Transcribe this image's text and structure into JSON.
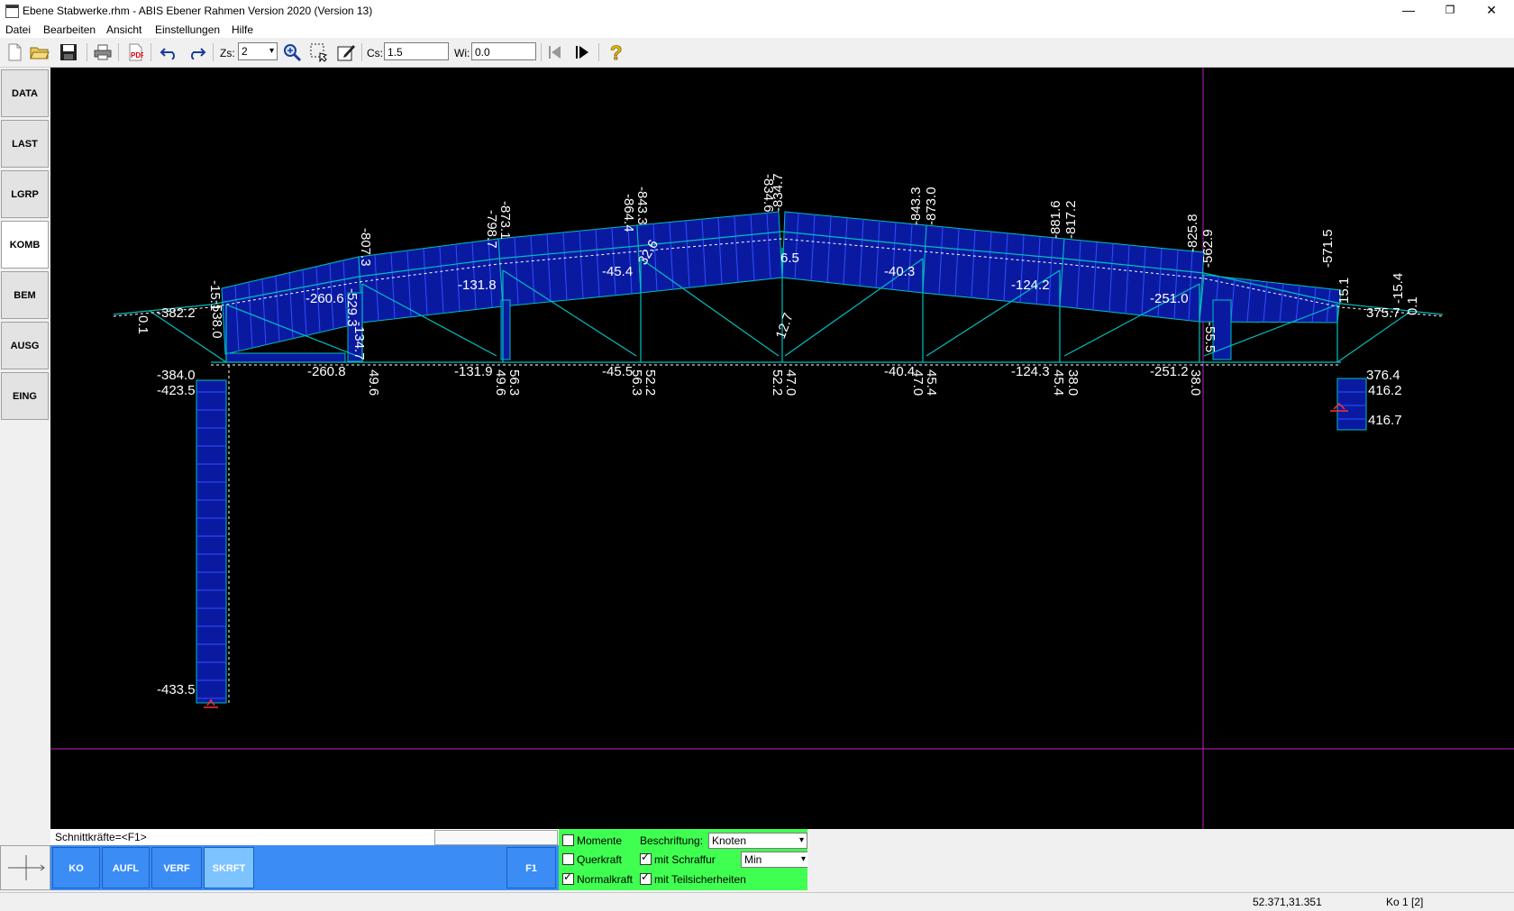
{
  "window": {
    "title": "Ebene Stabwerke.rhm - ABIS Ebener Rahmen Version 2020 (Version 13)",
    "minimize": "—",
    "restore": "❐",
    "close": "✕"
  },
  "menu": [
    "Datei",
    "Bearbeiten",
    "Ansicht",
    "Einstellungen",
    "Hilfe"
  ],
  "toolbar": {
    "zs_label": "Zs:",
    "zs_value": "2",
    "cs_label": "Cs:",
    "cs_value": "1.5",
    "wi_label": "Wi:",
    "wi_value": "0.0"
  },
  "sidebar": [
    "DATA",
    "LAST",
    "LGRP",
    "KOMB",
    "BEM",
    "AUSG",
    "EING"
  ],
  "sidebar_active": "KOMB",
  "status_line": {
    "label": "Schnittkräfte=<F1>"
  },
  "bottom_buttons": [
    "KO",
    "AUFL",
    "VERF",
    "SKRFT",
    "F1"
  ],
  "bottom_active": "SKRFT",
  "options": {
    "momente": "Momente",
    "querkraft": "Querkraft",
    "normalkraft": "Normalkraft",
    "beschriftung_label": "Beschriftung:",
    "beschriftung_value": "Knoten",
    "mit_schraffur": "mit Schraffur",
    "min_value": "Min",
    "mit_teilsicherheiten": "mit Teilsicherheiten",
    "checked": {
      "momente": false,
      "querkraft": false,
      "normalkraft": true,
      "mit_schraffur": true,
      "mit_teilsicherheiten": true
    }
  },
  "statusbar": {
    "coords": "52.371,31.351",
    "ko": "Ko 1 [2]"
  },
  "colors": {
    "canvas": "#000000",
    "member": "#00c0c0",
    "fill": "#0a1aa0",
    "hatch": "#3050ff",
    "labels": "#ffffff",
    "crosshair": "#c020c0",
    "green_panel": "#3fff50",
    "blue_bar": "#3b8cf5"
  },
  "diagram_labels": {
    "top_chord": [
      "-538.0",
      "-529.3",
      "-807.3",
      "-798.7",
      "-873.1",
      "-864.4",
      "-843.3",
      "-834.6",
      "-834.7",
      "-843.3",
      "-873.0",
      "-881.6",
      "-817.2",
      "-825.8",
      "-562.9",
      "-571.5",
      "15.1",
      "-15.4"
    ],
    "bottom_chord": [
      "-260.6",
      "-131.8",
      "-45.4",
      "6.5",
      "-40.3",
      "-124.2",
      "-251.0",
      "-260.8",
      "-131.9",
      "-45.5",
      "-40.4",
      "-124.3",
      "-251.2"
    ],
    "verticals": [
      "49.6",
      "49.6",
      "56.3",
      "56.3",
      "52.2",
      "52.2",
      "47.0",
      "47.0",
      "45.4",
      "45.4",
      "38.0",
      "38.0"
    ],
    "diagonals": [
      "-134.7",
      "32.6",
      "-55.5",
      "12.7"
    ],
    "ends": [
      "-382.2",
      "-384.0",
      "-423.5",
      "-433.5",
      "375.7",
      "376.4",
      "416.2",
      "416.7",
      "-15.1",
      "0.1",
      "0.1"
    ]
  }
}
